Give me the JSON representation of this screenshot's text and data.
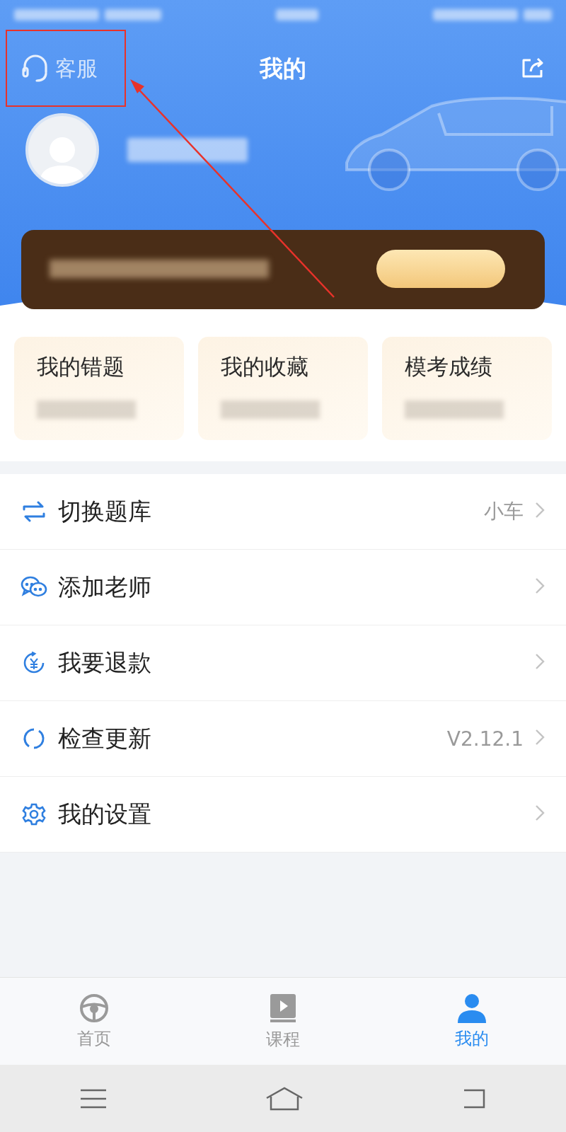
{
  "header": {
    "service": "客服",
    "title": "我的"
  },
  "cards": [
    {
      "title": "我的错题"
    },
    {
      "title": "我的收藏"
    },
    {
      "title": "模考成绩"
    }
  ],
  "menu": [
    {
      "kind": "switch",
      "label": "切换题库",
      "value": "小车"
    },
    {
      "kind": "chat",
      "label": "添加老师"
    },
    {
      "kind": "refund",
      "label": "我要退款"
    },
    {
      "kind": "update",
      "label": "检查更新",
      "value": "V2.12.1"
    },
    {
      "kind": "gear",
      "label": "我的设置"
    }
  ],
  "tabs": [
    {
      "kind": "wheel",
      "label": "首页",
      "selected": false
    },
    {
      "kind": "book",
      "label": "课程",
      "selected": false
    },
    {
      "kind": "person",
      "label": "我的",
      "selected": true
    }
  ]
}
